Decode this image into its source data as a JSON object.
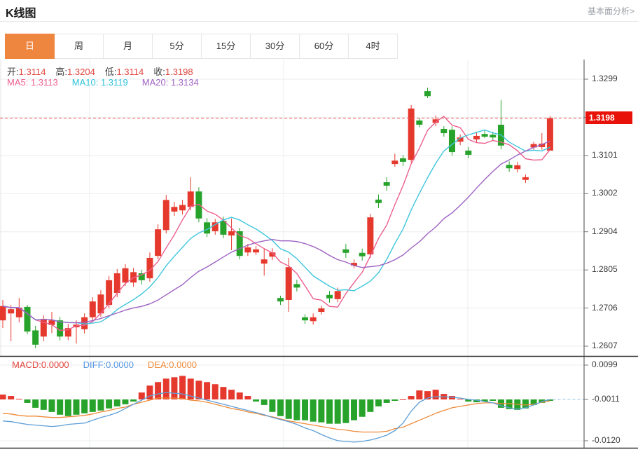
{
  "header": {
    "title": "K线图",
    "link": "基本面分析>"
  },
  "tabs": {
    "items": [
      {
        "label": "日",
        "name": "tab-day",
        "active": true
      },
      {
        "label": "周",
        "name": "tab-week",
        "active": false
      },
      {
        "label": "月",
        "name": "tab-month",
        "active": false
      },
      {
        "label": "5分",
        "name": "tab-5min",
        "active": false
      },
      {
        "label": "15分",
        "name": "tab-15min",
        "active": false
      },
      {
        "label": "30分",
        "name": "tab-30min",
        "active": false
      },
      {
        "label": "60分",
        "name": "tab-60min",
        "active": false
      },
      {
        "label": "4时",
        "name": "tab-4hour",
        "active": false
      }
    ]
  },
  "info_bar": {
    "open_label": "开:",
    "open": "1.3114",
    "high_label": "高:",
    "high": "1.3204",
    "low_label": "低:",
    "low": "1.3114",
    "close_label": "收:",
    "close": "1.3198"
  },
  "ma_bar": {
    "ma5_label": "MA5:",
    "ma5": "1.3113",
    "ma10_label": "MA10:",
    "ma10": "1.3119",
    "ma20_label": "MA20:",
    "ma20": "1.3134"
  },
  "macd_bar": {
    "macd_label": "MACD:",
    "macd": "0.0000",
    "diff_label": "DIFF:",
    "diff": "0.0000",
    "dea_label": "DEA:",
    "dea": "0.0000"
  },
  "y_axis": {
    "price_labels": [
      "1.3299",
      "1.3198",
      "1.3101",
      "1.3002",
      "1.2904",
      "1.2805",
      "1.2706",
      "1.2607"
    ],
    "current_price": "1.3198",
    "macd_labels": [
      "0.0099",
      "-0.0011",
      "-0.0120"
    ]
  },
  "colors": {
    "up": "#e6392e",
    "down": "#27a32b",
    "ma5": "#ec5f8e",
    "ma10": "#3ec6dc",
    "ma20": "#9e62c2",
    "diff_line": "#5d9fd8",
    "dea_line": "#ef8b3a",
    "grid": "#ebedee",
    "dash_red": "#f05a50",
    "zero_dash": "#90c4e8",
    "tag_bg": "#e8120a",
    "tab_active": "#ee8640",
    "border_dark": "#333333",
    "tick": "#777777"
  },
  "chart_data": {
    "type": "candlestick",
    "title": "K线图 (日K) + MACD",
    "legend": [
      "MA5",
      "MA10",
      "MA20",
      "MACD",
      "DIFF",
      "DEA"
    ],
    "price_axis": {
      "min": 1.2607,
      "max": 1.3299,
      "current": 1.3198,
      "tick_labels": [
        1.3299,
        1.3198,
        1.3101,
        1.3002,
        1.2904,
        1.2805,
        1.2706,
        1.2607
      ]
    },
    "macd_axis": {
      "max": 0.0099,
      "mid": -0.0011,
      "min": -0.012
    },
    "ma_periods": [
      5,
      10,
      20
    ],
    "candles": [
      [
        1.2674,
        1.2727,
        1.2654,
        1.2711
      ],
      [
        1.2692,
        1.2714,
        1.262,
        1.2703
      ],
      [
        1.2682,
        1.2732,
        1.2669,
        1.2707
      ],
      [
        1.2709,
        1.2714,
        1.2638,
        1.2645
      ],
      [
        1.2648,
        1.266,
        1.2602,
        1.2611
      ],
      [
        1.2632,
        1.2687,
        1.262,
        1.2678
      ],
      [
        1.2662,
        1.2696,
        1.2641,
        1.2674
      ],
      [
        1.2674,
        1.2683,
        1.2622,
        1.2632
      ],
      [
        1.2632,
        1.2665,
        1.2623,
        1.2654
      ],
      [
        1.2656,
        1.2674,
        1.2614,
        1.2663
      ],
      [
        1.2651,
        1.2692,
        1.264,
        1.2682
      ],
      [
        1.2682,
        1.2734,
        1.2671,
        1.2723
      ],
      [
        1.2692,
        1.2752,
        1.2683,
        1.2741
      ],
      [
        1.2714,
        1.2789,
        1.2705,
        1.2778
      ],
      [
        1.2745,
        1.2807,
        1.2734,
        1.2796
      ],
      [
        1.2772,
        1.282,
        1.2763,
        1.2809
      ],
      [
        1.2772,
        1.281,
        1.2761,
        1.2799
      ],
      [
        1.2796,
        1.2805,
        1.2767,
        1.2778
      ],
      [
        1.2783,
        1.285,
        1.2774,
        1.2836
      ],
      [
        1.2841,
        1.2923,
        1.2832,
        1.291
      ],
      [
        1.2908,
        1.2999,
        1.2899,
        1.2986
      ],
      [
        1.2956,
        1.2981,
        1.2945,
        1.2968
      ],
      [
        1.2959,
        1.2986,
        1.2948,
        1.2973
      ],
      [
        1.2968,
        1.3045,
        1.2959,
        1.3008
      ],
      [
        1.3008,
        1.3019,
        1.2928,
        1.2938
      ],
      [
        1.2928,
        1.2939,
        1.289,
        1.2899
      ],
      [
        1.2905,
        1.2937,
        1.2896,
        1.2928
      ],
      [
        1.2932,
        1.2943,
        1.2887,
        1.2896
      ],
      [
        1.2894,
        1.2938,
        1.2856,
        1.2905
      ],
      [
        1.2905,
        1.2914,
        1.2832,
        1.2841
      ],
      [
        1.285,
        1.2872,
        1.2841,
        1.2863
      ],
      [
        1.285,
        1.2867,
        1.2843,
        1.2858
      ],
      [
        1.2821,
        1.286,
        1.279,
        1.2832
      ],
      [
        1.2839,
        1.2861,
        1.283,
        1.285
      ],
      [
        1.2732,
        1.2738,
        1.2714,
        1.2723
      ],
      [
        1.2727,
        1.2836,
        1.2696,
        1.2812
      ],
      [
        1.2768,
        1.2779,
        1.2749,
        1.2759
      ],
      [
        1.2682,
        1.269,
        1.2665,
        1.2674
      ],
      [
        1.2672,
        1.2692,
        1.2663,
        1.2682
      ],
      [
        1.2696,
        1.2712,
        1.2689,
        1.2705
      ],
      [
        1.274,
        1.275,
        1.272,
        1.2731
      ],
      [
        1.2729,
        1.2759,
        1.2721,
        1.275
      ],
      [
        1.2858,
        1.2872,
        1.2836,
        1.2849
      ],
      [
        1.2816,
        1.2832,
        1.2809,
        1.2823
      ],
      [
        1.2849,
        1.286,
        1.2829,
        1.284
      ],
      [
        1.2845,
        1.295,
        1.2836,
        1.2941
      ],
      [
        1.2987,
        1.3,
        1.2965,
        1.2978
      ],
      [
        1.3032,
        1.3045,
        1.301,
        1.3023
      ],
      [
        1.3079,
        1.3106,
        1.3072,
        1.3088
      ],
      [
        1.3094,
        1.3103,
        1.3074,
        1.3085
      ],
      [
        1.309,
        1.3232,
        1.3083,
        1.3223
      ],
      [
        1.3192,
        1.3199,
        1.3174,
        1.3181
      ],
      [
        1.3268,
        1.3277,
        1.325,
        1.3255
      ],
      [
        1.3186,
        1.3205,
        1.3177,
        1.3195
      ],
      [
        1.317,
        1.3177,
        1.315,
        1.3159
      ],
      [
        1.3168,
        1.3177,
        1.3101,
        1.311
      ],
      [
        1.3137,
        1.3156,
        1.3128,
        1.3148
      ],
      [
        1.3114,
        1.3123,
        1.3094,
        1.3103
      ],
      [
        1.3143,
        1.3163,
        1.3134,
        1.3152
      ],
      [
        1.3157,
        1.3166,
        1.3146,
        1.315
      ],
      [
        1.3155,
        1.3163,
        1.3141,
        1.3148
      ],
      [
        1.3181,
        1.3245,
        1.3117,
        1.3127
      ],
      [
        1.3077,
        1.3086,
        1.3059,
        1.3068
      ],
      [
        1.3066,
        1.3085,
        1.3057,
        1.3076
      ],
      [
        1.3038,
        1.3052,
        1.303,
        1.3045
      ],
      [
        1.3122,
        1.3137,
        1.3114,
        1.3131
      ],
      [
        1.3123,
        1.3159,
        1.3116,
        1.3132
      ],
      [
        1.3114,
        1.3204,
        1.3114,
        1.3198
      ]
    ],
    "macd": {
      "histogram": [
        0.0014,
        0.001,
        0.0002,
        -0.001,
        -0.0024,
        -0.003,
        -0.0036,
        -0.0044,
        -0.0048,
        -0.0044,
        -0.004,
        -0.0036,
        -0.0032,
        -0.0026,
        -0.002,
        -0.0014,
        -0.0006,
        0.002,
        0.004,
        0.005,
        0.006,
        0.0064,
        0.0068,
        0.006,
        0.0054,
        0.005,
        0.0044,
        0.0036,
        0.0028,
        0.002,
        0.001,
        -0.0006,
        -0.0016,
        -0.0036,
        -0.0048,
        -0.0056,
        -0.006,
        -0.006,
        -0.0064,
        -0.0066,
        -0.007,
        -0.007,
        -0.0068,
        -0.006,
        -0.005,
        -0.0036,
        -0.002,
        -0.001,
        -0.0004,
        0.0,
        0.001,
        0.0026,
        0.0024,
        0.0028,
        0.0016,
        0.001,
        0.0002,
        -0.0006,
        -0.0008,
        -0.0006,
        -0.0004,
        -0.0024,
        -0.0028,
        -0.003,
        -0.0026,
        -0.0016,
        -0.001,
        -0.0004
      ],
      "diff": [
        -0.0062,
        -0.0064,
        -0.0068,
        -0.0072,
        -0.0074,
        -0.0076,
        -0.0078,
        -0.0076,
        -0.0072,
        -0.007,
        -0.0068,
        -0.006,
        -0.0052,
        -0.0046,
        -0.0038,
        -0.0026,
        -0.0014,
        -0.0002,
        0.001,
        0.0016,
        0.002,
        0.0018,
        0.0016,
        0.001,
        0.0004,
        -0.0002,
        -0.0008,
        -0.0014,
        -0.002,
        -0.0026,
        -0.0032,
        -0.0038,
        -0.0044,
        -0.0052,
        -0.0058,
        -0.0064,
        -0.0072,
        -0.0082,
        -0.009,
        -0.0101,
        -0.0111,
        -0.0119,
        -0.0121,
        -0.0123,
        -0.0121,
        -0.0117,
        -0.0111,
        -0.0103,
        -0.009,
        -0.0068,
        -0.0034,
        -0.0008,
        0.0004,
        0.0008,
        0.0008,
        0.0006,
        0.0004,
        0.0,
        -0.0002,
        -0.0006,
        -0.001,
        -0.0018,
        -0.0024,
        -0.0028,
        -0.0024,
        -0.0016,
        -0.0006,
        0.0
      ],
      "dea": [
        -0.004,
        -0.0042,
        -0.0046,
        -0.0048,
        -0.0048,
        -0.005,
        -0.0052,
        -0.0052,
        -0.005,
        -0.0048,
        -0.0046,
        -0.0042,
        -0.0036,
        -0.0032,
        -0.0026,
        -0.0022,
        -0.0014,
        -0.0008,
        -0.0002,
        0.0004,
        0.0004,
        0.0004,
        0.0002,
        -0.0002,
        -0.0004,
        -0.0008,
        -0.0014,
        -0.002,
        -0.0026,
        -0.003,
        -0.0036,
        -0.004,
        -0.0046,
        -0.005,
        -0.0056,
        -0.0062,
        -0.0066,
        -0.007,
        -0.0074,
        -0.0078,
        -0.0082,
        -0.0086,
        -0.0088,
        -0.0092,
        -0.0094,
        -0.0094,
        -0.0094,
        -0.0092,
        -0.0084,
        -0.008,
        -0.007,
        -0.006,
        -0.005,
        -0.004,
        -0.0032,
        -0.0024,
        -0.002,
        -0.0016,
        -0.0012,
        -0.001,
        -0.001,
        -0.0012,
        -0.0012,
        -0.0014,
        -0.0016,
        -0.0014,
        -0.0008,
        -0.0004
      ]
    }
  }
}
